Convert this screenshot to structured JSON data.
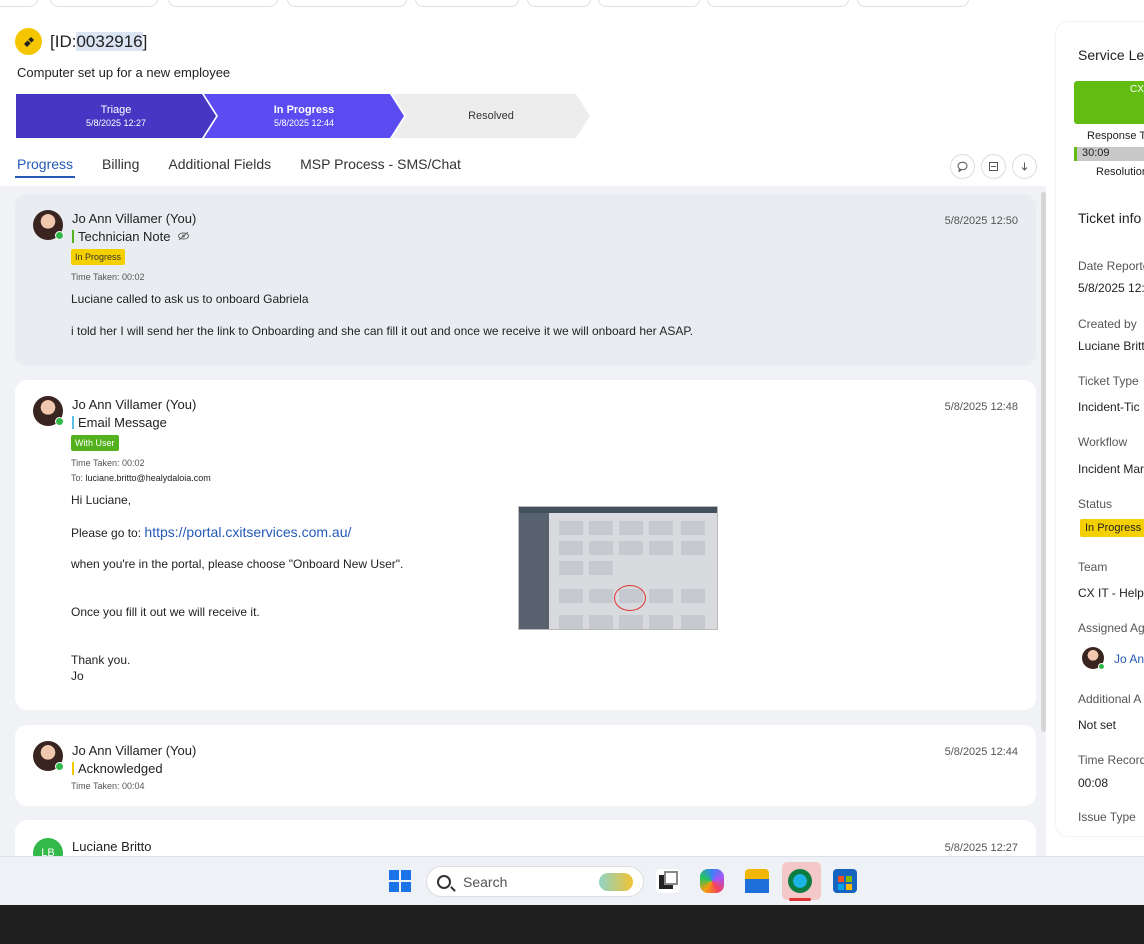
{
  "header": {
    "id_prefix": "[ID:",
    "id_number": "0032916",
    "id_suffix": "]",
    "subject": "Computer set up for a new employee"
  },
  "stages": [
    {
      "label": "Triage",
      "date": "5/8/2025 12:27"
    },
    {
      "label": "In Progress",
      "date": "5/8/2025 12:44"
    },
    {
      "label": "Resolved",
      "date": ""
    }
  ],
  "tabs": [
    "Progress",
    "Billing",
    "Additional Fields",
    "MSP Process - SMS/Chat"
  ],
  "feed": [
    {
      "author": "Jo Ann Villamer (You)",
      "type": "Technician Note",
      "badge": "In Progress",
      "time_taken": "Time Taken: 00:02",
      "timestamp": "5/8/2025 12:50",
      "lines": [
        "Luciane called to ask us to onboard Gabriela",
        "i told her I will send her the link to Onboarding and she can fill it out and once we receive it we will onboard her ASAP."
      ]
    },
    {
      "author": "Jo Ann Villamer (You)",
      "type": "Email Message",
      "badge": "With User",
      "time_taken": "Time Taken: 00:02",
      "to_label": "To:",
      "to": "luciane.britto@healydaloia.com",
      "timestamp": "5/8/2025 12:48",
      "greeting": "Hi Luciane,",
      "goto_text": "Please go to:",
      "link": "https://portal.cxitservices.com.au/",
      "line2": "when you're in the portal, please choose \"Onboard New User\".",
      "line3": "Once you fill it out we will receive it.",
      "thanks": "Thank you.",
      "sign": "Jo"
    },
    {
      "author": "Jo Ann Villamer (You)",
      "type": "Acknowledged",
      "time_taken": "Time Taken: 00:04",
      "timestamp": "5/8/2025 12:44"
    },
    {
      "author": "Luciane Britto",
      "initials": "LB",
      "timestamp": "5/8/2025 12:27"
    }
  ],
  "right_panel": {
    "sla_title": "Service Lev",
    "sla_bar_text": "CX",
    "response_label": "Response Ti",
    "response_value": "30:09",
    "resolution_label": "Resolution",
    "info_title": "Ticket info",
    "fields": [
      {
        "label": "Date Reporte",
        "value": "5/8/2025 12:"
      },
      {
        "label": "Created by",
        "value": "Luciane Britt"
      },
      {
        "label": "Ticket Type",
        "value": "Incident-Tic"
      },
      {
        "label": "Workflow",
        "value": "Incident Mar"
      },
      {
        "label": "Status",
        "value": "In Progress"
      },
      {
        "label": "Team",
        "value": "CX IT - Helpd"
      },
      {
        "label": "Assigned Ag",
        "value": "Jo An"
      },
      {
        "label": "Additional A",
        "value": "Not set"
      },
      {
        "label": "Time Record",
        "value": "00:08"
      },
      {
        "label": "Issue Type",
        "value": ""
      }
    ]
  },
  "taskbar": {
    "search_placeholder": "Search"
  },
  "colors": {
    "triage": "#4636c4",
    "in_progress": "#5a4cf0",
    "badge_yellow": "#f5d000",
    "badge_green": "#52b11c",
    "link": "#2459b8"
  }
}
